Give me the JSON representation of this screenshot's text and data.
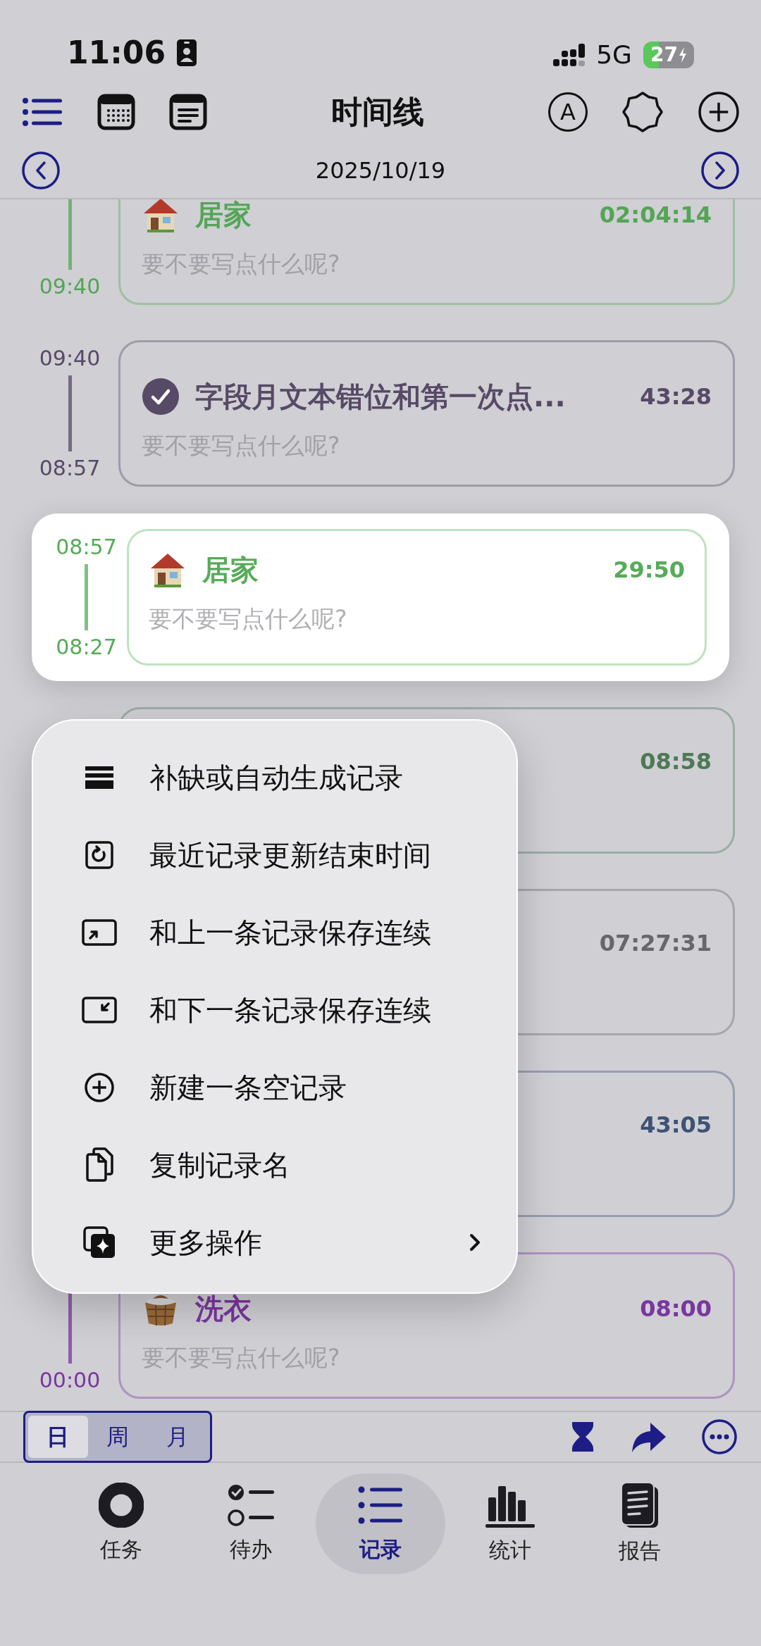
{
  "status_bar": {
    "time": "11:06",
    "network": "5G",
    "battery": "27"
  },
  "header": {
    "title": "时间线",
    "badge_letter": "A",
    "date": "2025/10/19"
  },
  "records": [
    {
      "end": "09:40",
      "kind": "house",
      "title": "居家",
      "duration": "02:04:14",
      "note": "要不要写点什么呢?",
      "color": "#54a556",
      "highlighted": false
    },
    {
      "start": "09:40",
      "end": "08:57",
      "kind": "check",
      "title": "字段月文本错位和第一次点...",
      "duration": "43:28",
      "note": "要不要写点什么呢?",
      "color": "#574a66",
      "highlighted": false
    },
    {
      "start": "08:57",
      "end": "08:27",
      "kind": "house",
      "title": "居家",
      "duration": "29:50",
      "note": "要不要写点什么呢?",
      "color": "#56ab58",
      "highlighted": true
    },
    {
      "duration": "08:58",
      "color": "#4d7a54",
      "highlighted": false
    },
    {
      "duration": "07:27:31",
      "color": "#66666c",
      "highlighted": false
    },
    {
      "duration": "43:05",
      "color": "#3e5276",
      "highlighted": false
    },
    {
      "end": "00:00",
      "kind": "basket",
      "title": "洗衣",
      "duration": "08:00",
      "note": "要不要写点什么呢?",
      "color": "#7a36a0",
      "highlighted": false
    }
  ],
  "context_menu": [
    {
      "kind": "stack",
      "label": "补缺或自动生成记录",
      "submenu": false
    },
    {
      "kind": "refresh",
      "label": "最近记录更新结束时间",
      "submenu": false
    },
    {
      "kind": "box-up",
      "label": "和上一条记录保存连续",
      "submenu": false
    },
    {
      "kind": "box-down",
      "label": "和下一条记录保存连续",
      "submenu": false
    },
    {
      "kind": "plus",
      "label": "新建一条空记录",
      "submenu": false
    },
    {
      "kind": "copy",
      "label": "复制记录名",
      "submenu": false
    },
    {
      "kind": "sparkle",
      "label": "更多操作",
      "submenu": true
    }
  ],
  "range_tabs": [
    {
      "label": "日",
      "selected": true
    },
    {
      "label": "周",
      "selected": false
    },
    {
      "label": "月",
      "selected": false
    }
  ],
  "tab_bar": [
    {
      "kind": "ring",
      "label": "任务",
      "selected": false
    },
    {
      "kind": "checklist",
      "label": "待办",
      "selected": false
    },
    {
      "kind": "list",
      "label": "记录",
      "selected": true
    },
    {
      "kind": "bars",
      "label": "统计",
      "selected": false
    },
    {
      "kind": "book",
      "label": "报告",
      "selected": false
    }
  ]
}
